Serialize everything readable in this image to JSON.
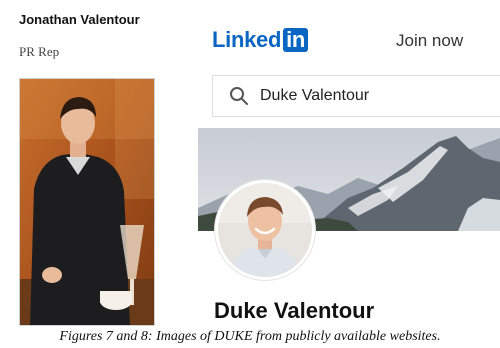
{
  "left_profile": {
    "name": "Jonathan Valentour",
    "title": "PR Rep"
  },
  "linkedin": {
    "logo_text": "Linked",
    "logo_box_text": "in",
    "join_label": "Join now",
    "search": {
      "value": "Duke Valentour",
      "icon": "search-icon"
    },
    "profile_name": "Duke Valentour"
  },
  "caption": "Figures 7 and 8: Images of DUKE from publicly available websites.",
  "colors": {
    "brand": "#0a66c2",
    "text": "#111111"
  }
}
